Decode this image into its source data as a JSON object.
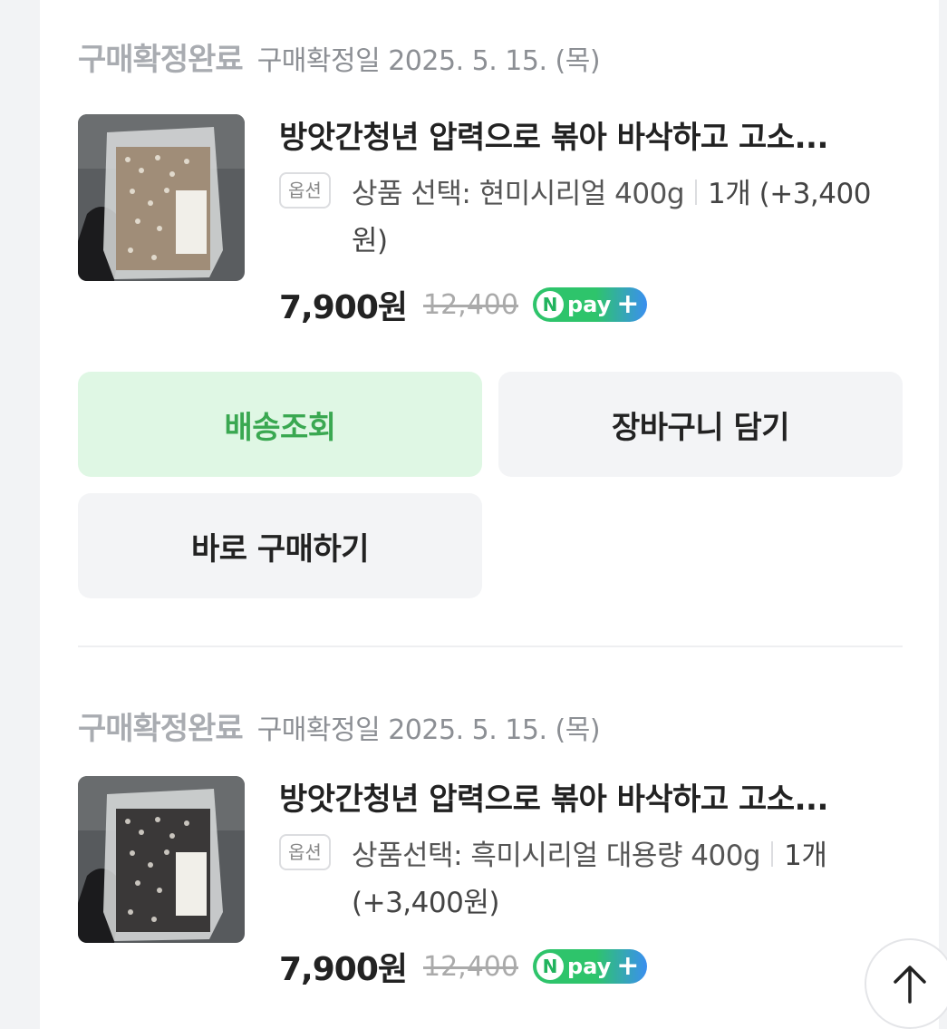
{
  "orders": [
    {
      "status": "구매확정완료",
      "date": "구매확정일 2025. 5. 15. (목)",
      "product_name": "방앗간청년 압력으로 볶아 바삭하고 고소...",
      "option_badge": "옵션",
      "option_text": "상품 선택: 현미시리얼 400g",
      "option_qty": "1개 (+3,400원)",
      "price": "7,900원",
      "original_price": "12,400",
      "npay_label": "pay"
    },
    {
      "status": "구매확정완료",
      "date": "구매확정일 2025. 5. 15. (목)",
      "product_name": "방앗간청년 압력으로 볶아 바삭하고 고소...",
      "option_badge": "옵션",
      "option_text": "상품선택: 흑미시리얼 대용량 400g",
      "option_qty": "1개 (+3,400원)",
      "price": "7,900원",
      "original_price": "12,400",
      "npay_label": "pay"
    }
  ],
  "actions": {
    "track_delivery": "배송조회",
    "add_to_cart": "장바구니 담기",
    "buy_now": "바로 구매하기"
  },
  "colors": {
    "accent_green": "#3aa851",
    "button_green_bg": "#dff7e4",
    "status_gray": "#a9acb1"
  },
  "icons": {
    "scroll_top": "arrow-up-icon",
    "npay": "npay-plus-icon"
  }
}
